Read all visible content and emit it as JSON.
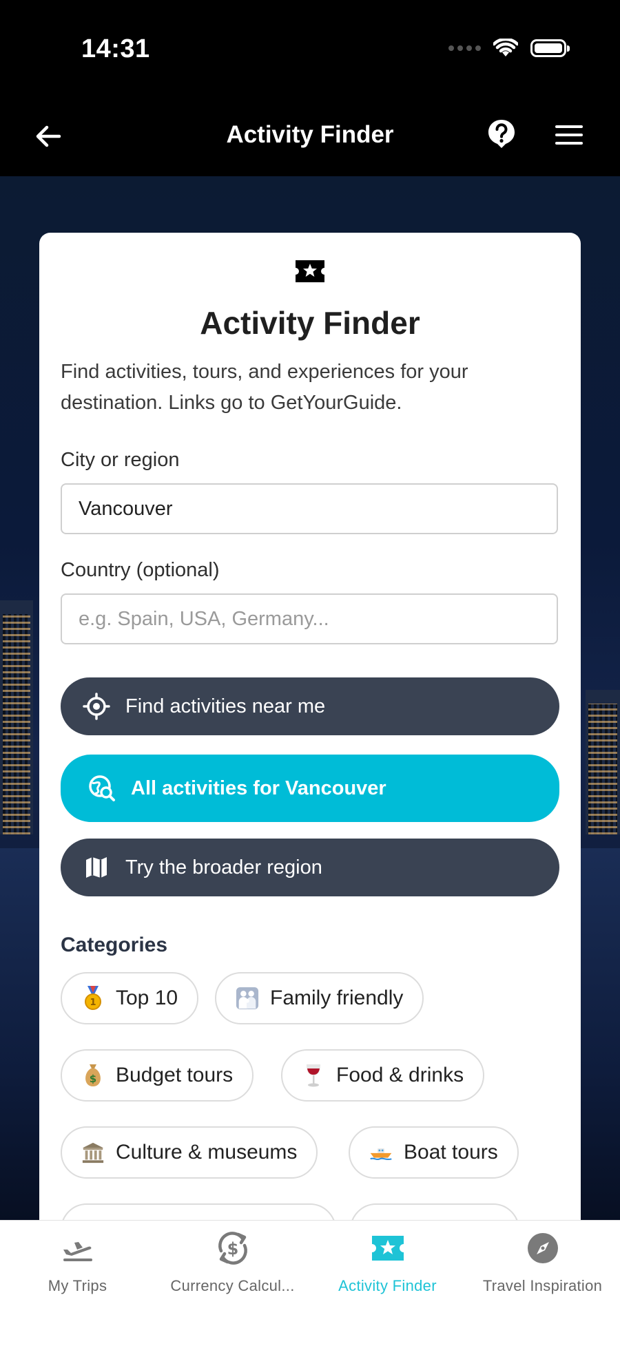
{
  "status_bar": {
    "time": "14:31"
  },
  "app_bar": {
    "title": "Activity Finder"
  },
  "card": {
    "title": "Activity Finder",
    "description": "Find activities, tours, and experiences for your destination. Links go to GetYourGuide.",
    "city_label": "City or region",
    "city_value": "Vancouver",
    "country_label": "Country (optional)",
    "country_placeholder": "e.g. Spain, USA, Germany...",
    "btn_near_me": "Find activities near me",
    "btn_all": "All activities for Vancouver",
    "btn_region": "Try the broader region",
    "categories_label": "Categories",
    "categories": [
      {
        "label": "Top 10",
        "icon": "medal-icon"
      },
      {
        "label": "Family friendly",
        "icon": "family-icon"
      },
      {
        "label": "Budget tours",
        "icon": "money-bag-icon"
      },
      {
        "label": "Food & drinks",
        "icon": "wine-glass-icon"
      },
      {
        "label": "Culture & museums",
        "icon": "museum-icon"
      },
      {
        "label": "Boat tours",
        "icon": "boat-icon"
      }
    ]
  },
  "bottom_nav": {
    "items": [
      {
        "label": "My Trips",
        "icon": "airplane-departure-icon",
        "active": false
      },
      {
        "label": "Currency Calcul...",
        "icon": "currency-exchange-icon",
        "active": false
      },
      {
        "label": "Activity Finder",
        "icon": "ticket-star-icon",
        "active": true
      },
      {
        "label": "Travel Inspiration",
        "icon": "compass-icon",
        "active": false
      }
    ]
  },
  "colors": {
    "accent": "#00bcd7",
    "dark_button": "#3a4353",
    "nav_active": "#1ec3d6"
  }
}
